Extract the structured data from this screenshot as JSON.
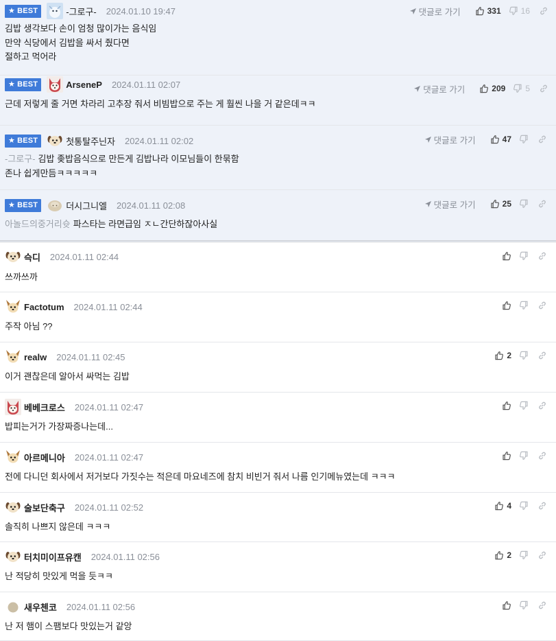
{
  "labels": {
    "best_badge": "BEST",
    "goto_reply": "댓글로 가기"
  },
  "colors": {
    "best_background": "#eef2f9",
    "best_badge": "#3f7bd9",
    "muted_text": "#8a8f98"
  },
  "comments": [
    {
      "best": true,
      "avatar": "snow-avatar",
      "nickname": "-그로구-",
      "bold": false,
      "date": "2024.01.10 19:47",
      "reply_to": "",
      "lines": [
        "김밥 생각보다 손이 엄청 많이가는 음식임",
        "만약 식당에서 김밥을 싸서 줬다면",
        "절하고 먹어라"
      ],
      "up": "331",
      "down": "16"
    },
    {
      "best": true,
      "avatar": "shiba-avatar",
      "nickname": "ArseneP",
      "bold": true,
      "date": "2024.01.11 02:07",
      "reply_to": "",
      "lines": [
        "근데 저렇게 줄 거면 차라리 고추장 줘서 비빔밥으로 주는 게 훨씬 나을 거 같은데ㅋㅋ"
      ],
      "up": "209",
      "down": "5"
    },
    {
      "best": true,
      "avatar": "puppy-avatar",
      "nickname": "첫통탈주닌자",
      "bold": false,
      "date": "2024.01.11 02:02",
      "reply_to": "-그로구-",
      "lines": [
        "김밥 좆밥음식으로 만든게 김밥나라 이모님들이 한묶함",
        "존나 쉽게만듬ㅋㅋㅋㅋㅋ"
      ],
      "up": "47",
      "down": ""
    },
    {
      "best": true,
      "avatar": "beige-avatar",
      "nickname": "더시그니엘",
      "bold": false,
      "date": "2024.01.11 02:08",
      "reply_to": "아놀드의중거리슛",
      "lines": [
        "파스타는 라면급임 ㅈㄴ간단하잖아사실"
      ],
      "up": "25",
      "down": ""
    },
    {
      "best": false,
      "avatar": "puppy-avatar",
      "nickname": "슥디",
      "bold": true,
      "date": "2024.01.11 02:44",
      "reply_to": "",
      "lines": [
        "쓰까쓰까"
      ],
      "up": "",
      "down": ""
    },
    {
      "best": false,
      "avatar": "chihuahua-avatar",
      "nickname": "Factotum",
      "bold": true,
      "date": "2024.01.11 02:44",
      "reply_to": "",
      "lines": [
        "주작 아님 ??"
      ],
      "up": "",
      "down": ""
    },
    {
      "best": false,
      "avatar": "chihuahua-avatar",
      "nickname": "realw",
      "bold": true,
      "date": "2024.01.11 02:45",
      "reply_to": "",
      "lines": [
        "이거 괜찮은데 알아서 싸먹는 김밥"
      ],
      "up": "2",
      "down": ""
    },
    {
      "best": false,
      "avatar": "shiba-avatar",
      "nickname": "베베크로스",
      "bold": true,
      "date": "2024.01.11 02:47",
      "reply_to": "",
      "lines": [
        "밥피는거가 가장짜증나는데..."
      ],
      "up": "",
      "down": ""
    },
    {
      "best": false,
      "avatar": "chihuahua-avatar",
      "nickname": "아르메니아",
      "bold": true,
      "date": "2024.01.11 02:47",
      "reply_to": "",
      "lines": [
        "전에 다니던 회사에서 저거보다 가짓수는 적은데 마요네즈에 참치 비빈거 줘서 나름 인기메뉴였는데 ㅋㅋㅋ"
      ],
      "up": "",
      "down": ""
    },
    {
      "best": false,
      "avatar": "puppy-avatar",
      "nickname": "술보단축구",
      "bold": true,
      "date": "2024.01.11 02:52",
      "reply_to": "",
      "lines": [
        "솔직히 나쁘지 않은데 ㅋㅋㅋ"
      ],
      "up": "4",
      "down": ""
    },
    {
      "best": false,
      "avatar": "puppy-avatar",
      "nickname": "터치미이프유캔",
      "bold": true,
      "date": "2024.01.11 02:56",
      "reply_to": "",
      "lines": [
        "난 적당히 맛있게 먹을 듯ㅋㅋ"
      ],
      "up": "2",
      "down": ""
    },
    {
      "best": false,
      "avatar": "circle-avatar",
      "nickname": "새우첸코",
      "bold": true,
      "date": "2024.01.11 02:56",
      "reply_to": "",
      "lines": [
        "난 저 햄이 스팸보다 맛있는거 같앙"
      ],
      "up": "",
      "down": ""
    }
  ]
}
